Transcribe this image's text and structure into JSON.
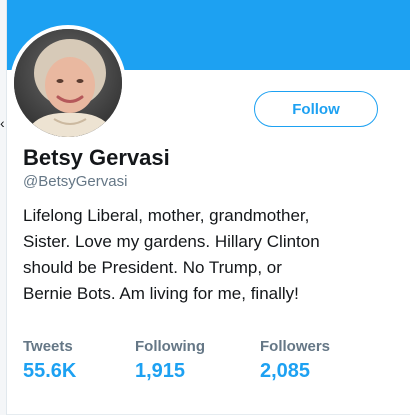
{
  "profile": {
    "display_name": "Betsy Gervasi",
    "handle": "@BetsyGervasi",
    "bio_lines": [
      "Lifelong Liberal, mother, grandmother,",
      "Sister. Love my gardens. Hillary Clinton",
      "should be President. No Trump, or",
      "Bernie Bots. Am living for me, finally!"
    ],
    "avatar_icon": "profile-photo"
  },
  "actions": {
    "follow_label": "Follow"
  },
  "stats": {
    "tweets": {
      "label": "Tweets",
      "value": "55.6K"
    },
    "following": {
      "label": "Following",
      "value": "1,915"
    },
    "followers": {
      "label": "Followers",
      "value": "2,085"
    }
  },
  "colors": {
    "accent": "#1da1f2",
    "text_primary": "#14171a",
    "text_secondary": "#657786",
    "background": "#ffffff"
  }
}
